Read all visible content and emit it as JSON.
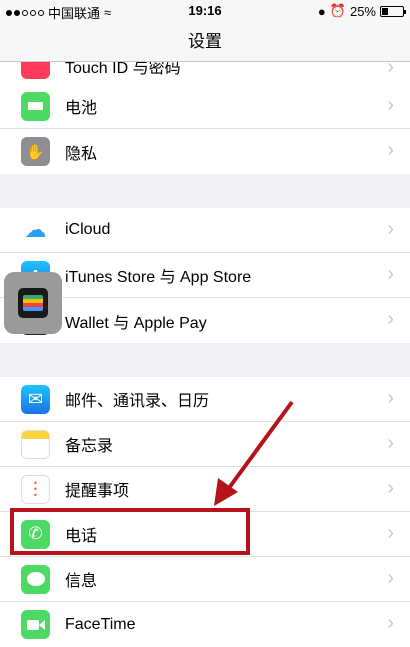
{
  "status": {
    "carrier": "中国联通",
    "time": "19:16",
    "battery": "25%"
  },
  "nav": {
    "title": "设置"
  },
  "touch_id": {
    "label": "Touch ID 与密码"
  },
  "group1": [
    {
      "label": "电池",
      "icon": "battery-icon",
      "color": "#4cd964"
    },
    {
      "label": "隐私",
      "icon": "hand-icon",
      "color": "#8e8e93"
    }
  ],
  "group2": [
    {
      "label": "iCloud",
      "icon": "cloud-icon",
      "color": "#ffffff"
    },
    {
      "label": "iTunes Store 与 App Store",
      "icon": "app-store-icon",
      "color": "#1a8cff"
    },
    {
      "label": "Wallet 与 Apple Pay",
      "icon": "wallet-icon",
      "color": "#222222"
    }
  ],
  "group3": [
    {
      "label": "邮件、通讯录、日历",
      "icon": "mail-icon",
      "color": "#1a8cff"
    },
    {
      "label": "备忘录",
      "icon": "notes-icon",
      "color": "#ffffff"
    },
    {
      "label": "提醒事项",
      "icon": "reminders-icon",
      "color": "#ffffff"
    },
    {
      "label": "电话",
      "icon": "phone-icon",
      "color": "#4cd964"
    },
    {
      "label": "信息",
      "icon": "messages-icon",
      "color": "#4cd964"
    },
    {
      "label": "FaceTime",
      "icon": "facetime-icon",
      "color": "#4cd964"
    }
  ],
  "annotation_color": "#b5121b"
}
